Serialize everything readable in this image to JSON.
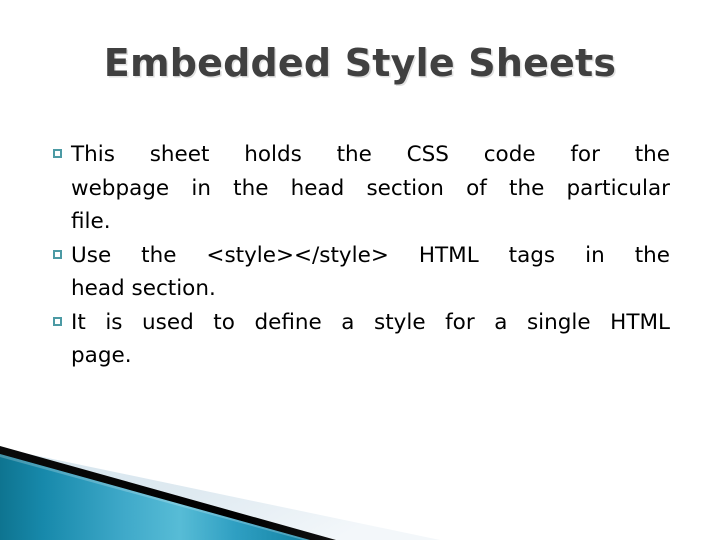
{
  "slide": {
    "title": "Embedded Style Sheets",
    "background_color": "#ffffff",
    "title_color": "#404040"
  },
  "body": {
    "bullet_marker": "hollow-square",
    "bullet_color": "#4c9aa4",
    "text_color": "#000000",
    "bullets": [
      {
        "id": "bullet-1",
        "text": "This sheet holds the CSS code for the webpage in the head section of the particular file.",
        "lines": [
          "This   sheet   holds   the   CSS   code   for   the",
          "webpage in the head section of the particular",
          "file."
        ]
      },
      {
        "id": "bullet-2",
        "text": "Use the <style></style> HTML tags in the head section.",
        "lines": [
          "Use  the  <style></style>  HTML  tags  in  the",
          "head section."
        ],
        "code_fragment": "<style></style>"
      },
      {
        "id": "bullet-3",
        "text": "It is used to define a style for a single HTML page.",
        "lines": [
          "It  is  used  to  define  a  style  for  a  single  HTML",
          "page."
        ]
      }
    ]
  },
  "decoration": {
    "name": "bottom-left-angled-banner",
    "teal_dark": "#0f7b9c",
    "teal_mid": "#2a9ec0",
    "teal_light": "#5bbdd6",
    "teal_edge": "#16809f",
    "black_band": "#000000",
    "pale_blue": "#dde9f0",
    "pale_blue_light": "#eef4f8"
  }
}
